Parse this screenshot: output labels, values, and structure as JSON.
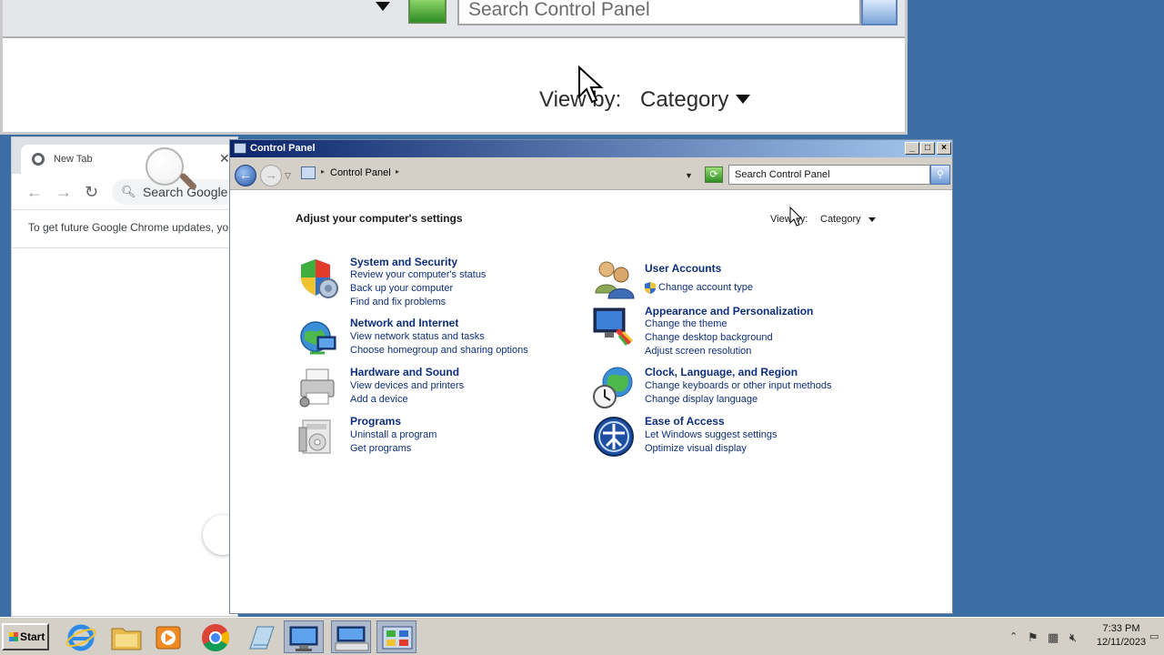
{
  "zoom_view": {
    "search_placeholder": "Search Control Panel",
    "view_by_label": "View by:",
    "view_by_value": "Category"
  },
  "chrome": {
    "tab_title": "New Tab",
    "omnibox_placeholder": "Search Google",
    "info_bar": "To get future Google Chrome updates, yo"
  },
  "control_panel": {
    "window_title": "Control Panel",
    "address": "Control Panel",
    "search_placeholder": "Search Control Panel",
    "heading": "Adjust your computer's settings",
    "view_by_label": "View by:",
    "view_by_value": "Category",
    "categories": [
      {
        "title": "System and Security",
        "links": [
          "Review your computer's status",
          "Back up your computer",
          "Find and fix problems"
        ]
      },
      {
        "title": "Network and Internet",
        "links": [
          "View network status and tasks",
          "Choose homegroup and sharing options"
        ]
      },
      {
        "title": "Hardware and Sound",
        "links": [
          "View devices and printers",
          "Add a device"
        ]
      },
      {
        "title": "Programs",
        "links": [
          "Uninstall a program",
          "Get programs"
        ]
      },
      {
        "title": "User Accounts",
        "links": [
          "Change account type"
        ]
      },
      {
        "title": "Appearance and Personalization",
        "links": [
          "Change the theme",
          "Change desktop background",
          "Adjust screen resolution"
        ]
      },
      {
        "title": "Clock, Language, and Region",
        "links": [
          "Change keyboards or other input methods",
          "Change display language"
        ]
      },
      {
        "title": "Ease of Access",
        "links": [
          "Let Windows suggest settings",
          "Optimize visual display"
        ]
      }
    ]
  },
  "taskbar": {
    "start_label": "Start",
    "apps": [
      "internet-explorer",
      "file-explorer",
      "media-player",
      "chrome",
      "notepad",
      "remote-desktop",
      "on-screen-keyboard",
      "control-panel"
    ],
    "clock_time": "7:33 PM",
    "clock_date": "12/11/2023"
  },
  "colors": {
    "desktop": "#3a6ea5",
    "link": "#0d2e7a",
    "titlebar_start": "#0a246a",
    "titlebar_end": "#a6caf0"
  }
}
